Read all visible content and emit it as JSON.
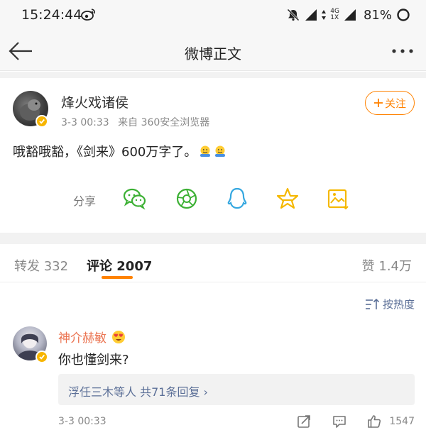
{
  "status_bar": {
    "time": "15:24:44",
    "network_top": "4G",
    "network_bottom": "1X",
    "battery": "81%"
  },
  "nav": {
    "title": "微博正文",
    "back_icon": "arrow-left-icon",
    "more_icon": "ellipsis-icon"
  },
  "post": {
    "username": "烽火戏诸侯",
    "time": "3-3 00:33",
    "source": "来自 360安全浏览器",
    "follow_label": "关注",
    "text": "哦豁哦豁，《剑来》600万字了。",
    "share_label": "分享",
    "share_icons": [
      "wechat-icon",
      "moments-icon",
      "qq-icon",
      "qzone-icon",
      "save-image-icon"
    ]
  },
  "tabs": {
    "reposts": "转发 332",
    "comments": "评论 2007",
    "likes": "赞 1.4万"
  },
  "sort": {
    "label": "按热度"
  },
  "comment": {
    "username": "神介赫敏",
    "text": "你也懂剑来?",
    "replies_link": "浮任三木等人 共71条回复 ›",
    "time": "3-3 00:33",
    "like_count": "1547"
  },
  "colors": {
    "accent": "#ff8200",
    "link": "#5b6f97",
    "comment_user": "#eb7350",
    "share_green": "#3cb034",
    "share_blue": "#34a7e0",
    "share_yellow": "#f5b800"
  }
}
